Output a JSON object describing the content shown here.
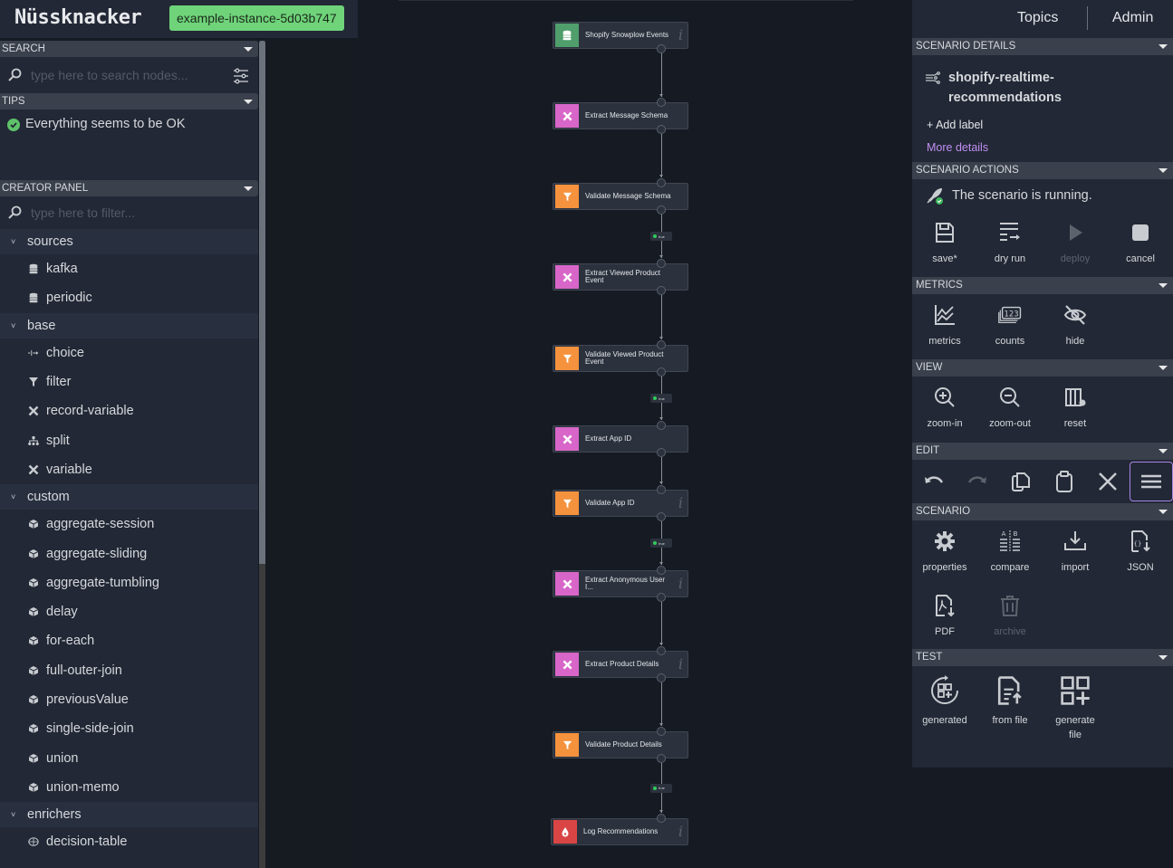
{
  "header": {
    "logo": "Nüssknacker",
    "environment": "example-instance-5d03b747",
    "environment_color": "#6fd37a"
  },
  "left_panel": {
    "search": {
      "title": "SEARCH",
      "placeholder": "type here to search nodes..."
    },
    "tips": {
      "title": "TIPS",
      "message": "Everything seems to be OK"
    },
    "creator": {
      "title": "CREATOR PANEL",
      "filter_placeholder": "type here to filter...",
      "groups": [
        {
          "label": "sources",
          "items": [
            {
              "label": "kafka",
              "icon": "database-icon"
            },
            {
              "label": "periodic",
              "icon": "database-icon"
            }
          ]
        },
        {
          "label": "base",
          "items": [
            {
              "label": "choice",
              "icon": "choice-icon"
            },
            {
              "label": "filter",
              "icon": "filter-icon"
            },
            {
              "label": "record-variable",
              "icon": "variable-icon"
            },
            {
              "label": "split",
              "icon": "split-icon"
            },
            {
              "label": "variable",
              "icon": "variable-icon"
            }
          ]
        },
        {
          "label": "custom",
          "items": [
            {
              "label": "aggregate-session",
              "icon": "cube-icon"
            },
            {
              "label": "aggregate-sliding",
              "icon": "cube-icon"
            },
            {
              "label": "aggregate-tumbling",
              "icon": "cube-icon"
            },
            {
              "label": "delay",
              "icon": "cube-icon"
            },
            {
              "label": "for-each",
              "icon": "cube-icon"
            },
            {
              "label": "full-outer-join",
              "icon": "cube-icon"
            },
            {
              "label": "previousValue",
              "icon": "cube-icon"
            },
            {
              "label": "single-side-join",
              "icon": "cube-icon"
            },
            {
              "label": "union",
              "icon": "cube-icon"
            },
            {
              "label": "union-memo",
              "icon": "cube-icon"
            }
          ]
        },
        {
          "label": "enrichers",
          "items": [
            {
              "label": "decision-table",
              "icon": "table-icon"
            }
          ]
        }
      ]
    }
  },
  "graph": {
    "nodes": [
      {
        "label": "Shopify Snowplow Events",
        "type": "source",
        "info": true
      },
      {
        "label": "Extract Message Schema",
        "type": "variable",
        "info": false
      },
      {
        "label": "Validate Message Schema",
        "type": "filter",
        "info": false
      },
      {
        "label": "Extract Viewed Product Event",
        "type": "variable",
        "info": false
      },
      {
        "label": "Validate Viewed Product Event",
        "type": "filter",
        "info": false
      },
      {
        "label": "Extract App ID",
        "type": "variable",
        "info": false
      },
      {
        "label": "Validate App ID",
        "type": "filter",
        "info": true
      },
      {
        "label": "Extract Anonymous User I...",
        "type": "variable",
        "info": true
      },
      {
        "label": "Extract Product Details",
        "type": "variable",
        "info": true
      },
      {
        "label": "Validate Product Details",
        "type": "filter",
        "info": false
      },
      {
        "label": "Log Recommendations",
        "type": "sink",
        "info": true
      }
    ],
    "edge_label": "true",
    "type_colors": {
      "source": "#4f9e6b",
      "variable": "#d866c8",
      "filter": "#f5923e",
      "sink": "#d94545"
    }
  },
  "right_panel": {
    "nav": {
      "topics": "Topics",
      "admin": "Admin"
    },
    "details": {
      "title": "SCENARIO DETAILS",
      "name_line1": "shopify-realtime-",
      "name_line2": "recommendations",
      "add_label": "+ Add label",
      "more_details": "More details"
    },
    "actions": {
      "title": "SCENARIO ACTIONS",
      "status": "The scenario is running.",
      "buttons": [
        {
          "label": "save*",
          "icon": "save-icon",
          "disabled": false
        },
        {
          "label": "dry run",
          "icon": "dry-run-icon",
          "disabled": false
        },
        {
          "label": "deploy",
          "icon": "play-icon",
          "disabled": true
        },
        {
          "label": "cancel",
          "icon": "stop-icon",
          "disabled": false
        }
      ]
    },
    "metrics": {
      "title": "METRICS",
      "buttons": [
        {
          "label": "metrics",
          "icon": "chart-icon"
        },
        {
          "label": "counts",
          "icon": "counts-icon"
        },
        {
          "label": "hide",
          "icon": "eye-off-icon"
        }
      ]
    },
    "view": {
      "title": "VIEW",
      "buttons": [
        {
          "label": "zoom-in",
          "icon": "zoom-in-icon"
        },
        {
          "label": "zoom-out",
          "icon": "zoom-out-icon"
        },
        {
          "label": "reset",
          "icon": "reset-layout-icon"
        }
      ]
    },
    "edit": {
      "title": "EDIT",
      "buttons": [
        "undo",
        "redo",
        "copy",
        "paste",
        "delete",
        "layout"
      ]
    },
    "scenario": {
      "title": "SCENARIO",
      "buttons": [
        {
          "label": "properties",
          "icon": "gear-icon",
          "disabled": false
        },
        {
          "label": "compare",
          "icon": "compare-icon",
          "disabled": false
        },
        {
          "label": "import",
          "icon": "import-icon",
          "disabled": false
        },
        {
          "label": "JSON",
          "icon": "json-icon",
          "disabled": false
        },
        {
          "label": "PDF",
          "icon": "pdf-icon",
          "disabled": false
        },
        {
          "label": "archive",
          "icon": "trash-icon",
          "disabled": true
        }
      ]
    },
    "test": {
      "title": "TEST",
      "buttons": [
        {
          "label": "generated",
          "icon": "generated-icon"
        },
        {
          "label": "from file",
          "icon": "from-file-icon"
        },
        {
          "label": "generate file",
          "icon": "generate-file-icon"
        }
      ]
    }
  }
}
